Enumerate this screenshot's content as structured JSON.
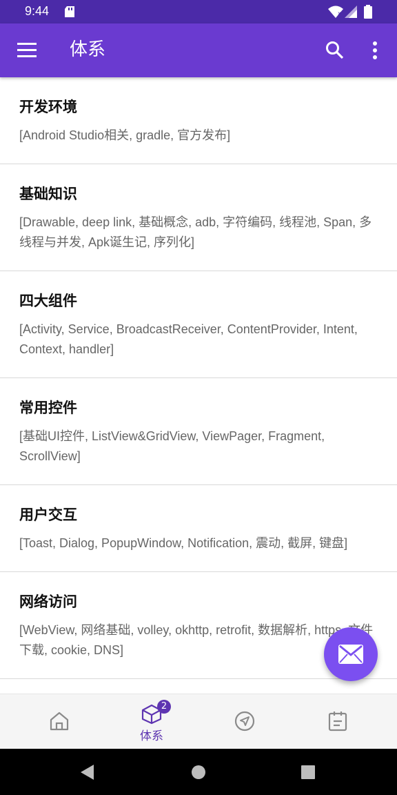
{
  "status_bar": {
    "time": "9:44"
  },
  "app_bar": {
    "title": "体系"
  },
  "categories": [
    {
      "title": "开发环境",
      "tags": "[Android Studio相关, gradle, 官方发布]"
    },
    {
      "title": "基础知识",
      "tags": "[Drawable, deep link, 基础概念, adb, 字符编码, 线程池, Span, 多线程与并发, Apk诞生记, 序列化]"
    },
    {
      "title": "四大组件",
      "tags": "[Activity, Service, BroadcastReceiver, ContentProvider, Intent, Context, handler]"
    },
    {
      "title": "常用控件",
      "tags": "[基础UI控件, ListView&GridView, ViewPager, Fragment, ScrollView]"
    },
    {
      "title": "用户交互",
      "tags": "[Toast, Dialog, PopupWindow, Notification, 震动, 截屏, 键盘]"
    },
    {
      "title": "网络访问",
      "tags": "[WebView, 网络基础, volley, okhttp, retrofit, 数据解析, https, 文件下载, cookie, DNS]"
    }
  ],
  "bottom_nav": {
    "items": [
      {
        "icon": "home-icon",
        "label": ""
      },
      {
        "icon": "cube-icon",
        "label": "体系",
        "badge": "2"
      },
      {
        "icon": "navigation-icon",
        "label": ""
      },
      {
        "icon": "clipboard-icon",
        "label": ""
      }
    ],
    "active_index": 1
  },
  "colors": {
    "status_bar": "#4b2aa8",
    "app_bar": "#6a3ad0",
    "accent": "#5e35b1",
    "fab": "#7b4ff0"
  }
}
